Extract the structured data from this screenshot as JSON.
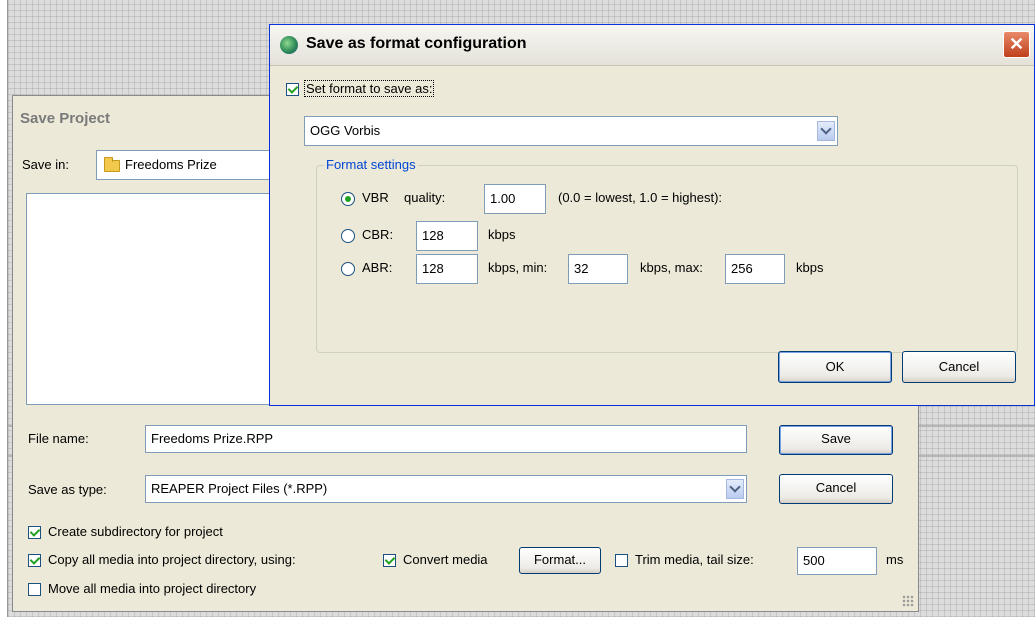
{
  "save_project": {
    "title": "Save Project",
    "save_in_label": "Save in:",
    "save_in_value": "Freedoms Prize",
    "file_name_label": "File name:",
    "file_name_value": "Freedoms Prize.RPP",
    "save_as_type_label": "Save as type:",
    "save_as_type_value": "REAPER Project Files (*.RPP)",
    "save_button": "Save",
    "cancel_button": "Cancel",
    "create_subdir_label": "Create subdirectory for project",
    "copy_media_label": "Copy all media into project directory, using:",
    "convert_media_label": "Convert media",
    "format_button": "Format...",
    "trim_media_label": "Trim media, tail size:",
    "tail_size_value": "500",
    "tail_unit": "ms",
    "move_media_label": "Move all media into project directory",
    "checks": {
      "create_subdir": true,
      "copy_media": true,
      "convert_media": true,
      "trim_media": false,
      "move_media": false
    }
  },
  "format_dialog": {
    "title": "Save as format configuration",
    "close_symbol": "✕",
    "set_format_label": "Set format to save as:",
    "set_format_checked": true,
    "format_selected": "OGG Vorbis",
    "group_title": "Format settings",
    "vbr": {
      "label": "VBR",
      "quality_label": "quality:",
      "quality_value": "1.00",
      "range_note": "(0.0 = lowest, 1.0 = highest):",
      "selected": true
    },
    "cbr": {
      "label": "CBR:",
      "value": "128",
      "unit": "kbps",
      "selected": false
    },
    "abr": {
      "label": "ABR:",
      "value": "128",
      "min_label": "kbps, min:",
      "min_value": "32",
      "max_label": "kbps, max:",
      "max_value": "256",
      "unit": "kbps",
      "selected": false
    },
    "ok_button": "OK",
    "cancel_button": "Cancel"
  },
  "colors": {
    "dialog_bg": "#ece9d8",
    "accent_blue": "#0046d5",
    "check_green": "#21a121",
    "close_red": "#c0401c"
  }
}
